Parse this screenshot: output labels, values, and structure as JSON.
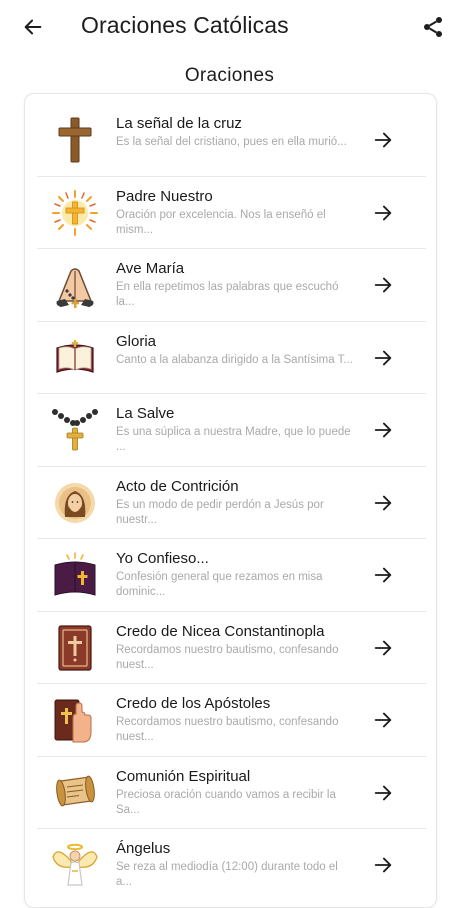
{
  "app_bar": {
    "title": "Oraciones Católicas",
    "back_icon": "arrow-left-icon",
    "share_icon": "share-icon"
  },
  "section": {
    "title": "Oraciones"
  },
  "prayers": [
    {
      "title": "La señal de la cruz",
      "subtitle": "Es la señal del cristiano, pues en ella murió...",
      "icon": "wooden-cross-icon"
    },
    {
      "title": "Padre Nuestro",
      "subtitle": "Oración por excelencia. Nos la enseñó el mism...",
      "icon": "radiant-cross-icon"
    },
    {
      "title": "Ave María",
      "subtitle": "En ella repetimos las palabras que escuchó la...",
      "icon": "praying-hands-rosary-icon"
    },
    {
      "title": "Gloria",
      "subtitle": "Canto a la alabanza dirigido a la Santísima T...",
      "icon": "open-bible-icon"
    },
    {
      "title": "La Salve",
      "subtitle": "Es una súplica a nuestra Madre, que lo puede ...",
      "icon": "rosary-icon"
    },
    {
      "title": "Acto de Contrición",
      "subtitle": "Es un modo de pedir perdón a Jesús por nuestr...",
      "icon": "jesus-portrait-icon"
    },
    {
      "title": "Yo Confieso...",
      "subtitle": "Confesión general que rezamos en misa dominic...",
      "icon": "holy-bible-icon"
    },
    {
      "title": "Credo de Nicea Constantinopla",
      "subtitle": "Recordamos nuestro bautismo, confesando nuest...",
      "icon": "ornate-bible-icon"
    },
    {
      "title": "Credo de los Apóstoles",
      "subtitle": "Recordamos nuestro bautismo, confesando nuest...",
      "icon": "hand-on-bible-icon"
    },
    {
      "title": "Comunión Espiritual",
      "subtitle": "Preciosa oración cuando vamos a recibir la Sa...",
      "icon": "scroll-icon"
    },
    {
      "title": "Ángelus",
      "subtitle": "Se reza al mediodía (12:00) durante todo el a...",
      "icon": "angel-icon"
    }
  ],
  "row_arrow_icon": "arrow-right-icon",
  "colors": {
    "background": "#ffffff",
    "text": "#1a1a1a",
    "subtitle": "#a9a9a9",
    "divider": "#e9e9e9"
  }
}
